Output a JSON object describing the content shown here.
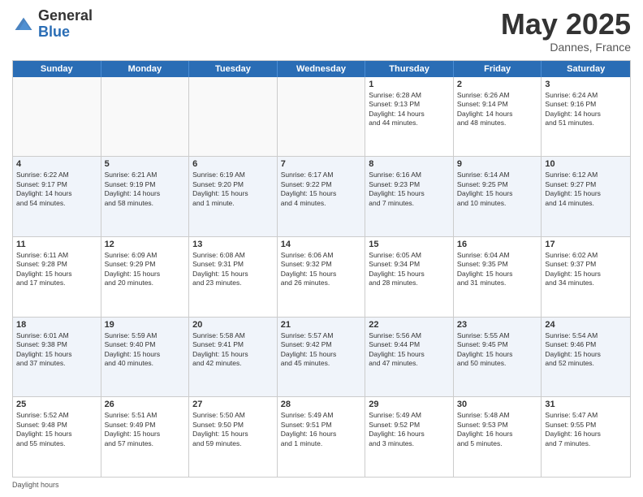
{
  "logo": {
    "general": "General",
    "blue": "Blue"
  },
  "title": {
    "month": "May 2025",
    "location": "Dannes, France"
  },
  "header_days": [
    "Sunday",
    "Monday",
    "Tuesday",
    "Wednesday",
    "Thursday",
    "Friday",
    "Saturday"
  ],
  "weeks": [
    [
      {
        "day": "",
        "lines": [],
        "empty": true
      },
      {
        "day": "",
        "lines": [],
        "empty": true
      },
      {
        "day": "",
        "lines": [],
        "empty": true
      },
      {
        "day": "",
        "lines": [],
        "empty": true
      },
      {
        "day": "1",
        "lines": [
          "Sunrise: 6:28 AM",
          "Sunset: 9:13 PM",
          "Daylight: 14 hours",
          "and 44 minutes."
        ],
        "empty": false
      },
      {
        "day": "2",
        "lines": [
          "Sunrise: 6:26 AM",
          "Sunset: 9:14 PM",
          "Daylight: 14 hours",
          "and 48 minutes."
        ],
        "empty": false
      },
      {
        "day": "3",
        "lines": [
          "Sunrise: 6:24 AM",
          "Sunset: 9:16 PM",
          "Daylight: 14 hours",
          "and 51 minutes."
        ],
        "empty": false
      }
    ],
    [
      {
        "day": "4",
        "lines": [
          "Sunrise: 6:22 AM",
          "Sunset: 9:17 PM",
          "Daylight: 14 hours",
          "and 54 minutes."
        ],
        "empty": false
      },
      {
        "day": "5",
        "lines": [
          "Sunrise: 6:21 AM",
          "Sunset: 9:19 PM",
          "Daylight: 14 hours",
          "and 58 minutes."
        ],
        "empty": false
      },
      {
        "day": "6",
        "lines": [
          "Sunrise: 6:19 AM",
          "Sunset: 9:20 PM",
          "Daylight: 15 hours",
          "and 1 minute."
        ],
        "empty": false
      },
      {
        "day": "7",
        "lines": [
          "Sunrise: 6:17 AM",
          "Sunset: 9:22 PM",
          "Daylight: 15 hours",
          "and 4 minutes."
        ],
        "empty": false
      },
      {
        "day": "8",
        "lines": [
          "Sunrise: 6:16 AM",
          "Sunset: 9:23 PM",
          "Daylight: 15 hours",
          "and 7 minutes."
        ],
        "empty": false
      },
      {
        "day": "9",
        "lines": [
          "Sunrise: 6:14 AM",
          "Sunset: 9:25 PM",
          "Daylight: 15 hours",
          "and 10 minutes."
        ],
        "empty": false
      },
      {
        "day": "10",
        "lines": [
          "Sunrise: 6:12 AM",
          "Sunset: 9:27 PM",
          "Daylight: 15 hours",
          "and 14 minutes."
        ],
        "empty": false
      }
    ],
    [
      {
        "day": "11",
        "lines": [
          "Sunrise: 6:11 AM",
          "Sunset: 9:28 PM",
          "Daylight: 15 hours",
          "and 17 minutes."
        ],
        "empty": false
      },
      {
        "day": "12",
        "lines": [
          "Sunrise: 6:09 AM",
          "Sunset: 9:29 PM",
          "Daylight: 15 hours",
          "and 20 minutes."
        ],
        "empty": false
      },
      {
        "day": "13",
        "lines": [
          "Sunrise: 6:08 AM",
          "Sunset: 9:31 PM",
          "Daylight: 15 hours",
          "and 23 minutes."
        ],
        "empty": false
      },
      {
        "day": "14",
        "lines": [
          "Sunrise: 6:06 AM",
          "Sunset: 9:32 PM",
          "Daylight: 15 hours",
          "and 26 minutes."
        ],
        "empty": false
      },
      {
        "day": "15",
        "lines": [
          "Sunrise: 6:05 AM",
          "Sunset: 9:34 PM",
          "Daylight: 15 hours",
          "and 28 minutes."
        ],
        "empty": false
      },
      {
        "day": "16",
        "lines": [
          "Sunrise: 6:04 AM",
          "Sunset: 9:35 PM",
          "Daylight: 15 hours",
          "and 31 minutes."
        ],
        "empty": false
      },
      {
        "day": "17",
        "lines": [
          "Sunrise: 6:02 AM",
          "Sunset: 9:37 PM",
          "Daylight: 15 hours",
          "and 34 minutes."
        ],
        "empty": false
      }
    ],
    [
      {
        "day": "18",
        "lines": [
          "Sunrise: 6:01 AM",
          "Sunset: 9:38 PM",
          "Daylight: 15 hours",
          "and 37 minutes."
        ],
        "empty": false
      },
      {
        "day": "19",
        "lines": [
          "Sunrise: 5:59 AM",
          "Sunset: 9:40 PM",
          "Daylight: 15 hours",
          "and 40 minutes."
        ],
        "empty": false
      },
      {
        "day": "20",
        "lines": [
          "Sunrise: 5:58 AM",
          "Sunset: 9:41 PM",
          "Daylight: 15 hours",
          "and 42 minutes."
        ],
        "empty": false
      },
      {
        "day": "21",
        "lines": [
          "Sunrise: 5:57 AM",
          "Sunset: 9:42 PM",
          "Daylight: 15 hours",
          "and 45 minutes."
        ],
        "empty": false
      },
      {
        "day": "22",
        "lines": [
          "Sunrise: 5:56 AM",
          "Sunset: 9:44 PM",
          "Daylight: 15 hours",
          "and 47 minutes."
        ],
        "empty": false
      },
      {
        "day": "23",
        "lines": [
          "Sunrise: 5:55 AM",
          "Sunset: 9:45 PM",
          "Daylight: 15 hours",
          "and 50 minutes."
        ],
        "empty": false
      },
      {
        "day": "24",
        "lines": [
          "Sunrise: 5:54 AM",
          "Sunset: 9:46 PM",
          "Daylight: 15 hours",
          "and 52 minutes."
        ],
        "empty": false
      }
    ],
    [
      {
        "day": "25",
        "lines": [
          "Sunrise: 5:52 AM",
          "Sunset: 9:48 PM",
          "Daylight: 15 hours",
          "and 55 minutes."
        ],
        "empty": false
      },
      {
        "day": "26",
        "lines": [
          "Sunrise: 5:51 AM",
          "Sunset: 9:49 PM",
          "Daylight: 15 hours",
          "and 57 minutes."
        ],
        "empty": false
      },
      {
        "day": "27",
        "lines": [
          "Sunrise: 5:50 AM",
          "Sunset: 9:50 PM",
          "Daylight: 15 hours",
          "and 59 minutes."
        ],
        "empty": false
      },
      {
        "day": "28",
        "lines": [
          "Sunrise: 5:49 AM",
          "Sunset: 9:51 PM",
          "Daylight: 16 hours",
          "and 1 minute."
        ],
        "empty": false
      },
      {
        "day": "29",
        "lines": [
          "Sunrise: 5:49 AM",
          "Sunset: 9:52 PM",
          "Daylight: 16 hours",
          "and 3 minutes."
        ],
        "empty": false
      },
      {
        "day": "30",
        "lines": [
          "Sunrise: 5:48 AM",
          "Sunset: 9:53 PM",
          "Daylight: 16 hours",
          "and 5 minutes."
        ],
        "empty": false
      },
      {
        "day": "31",
        "lines": [
          "Sunrise: 5:47 AM",
          "Sunset: 9:55 PM",
          "Daylight: 16 hours",
          "and 7 minutes."
        ],
        "empty": false
      }
    ]
  ],
  "footer": "Daylight hours"
}
